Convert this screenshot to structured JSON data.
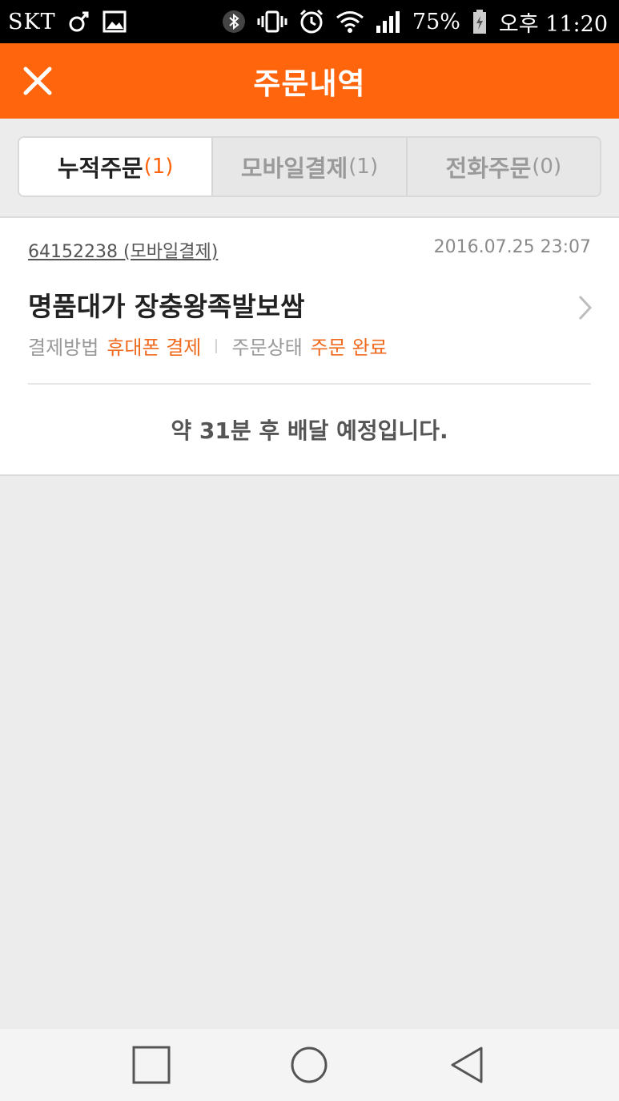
{
  "status_bar": {
    "carrier": "SKT",
    "battery": "75%",
    "time": "오후 11:20"
  },
  "app_bar": {
    "title": "주문내역"
  },
  "tabs": [
    {
      "label": "누적주문",
      "count": "(1)",
      "active": true
    },
    {
      "label": "모바일결제",
      "count": "(1)",
      "active": false
    },
    {
      "label": "전화주문",
      "count": "(0)",
      "active": false
    }
  ],
  "order": {
    "order_number": "64152238 (모바일결제)",
    "date": "2016.07.25 23:07",
    "store_name": "명품대가 장충왕족발보쌈",
    "payment_label": "결제방법",
    "payment_value": "휴대폰 결제",
    "status_label": "주문상태",
    "status_value": "주문 완료",
    "delivery_message": "약 31분 후 배달 예정입니다."
  },
  "colors": {
    "accent": "#ff650d",
    "accent_text": "#f06a1e"
  },
  "icons": {
    "close": "close-icon",
    "chevron": "chevron-right-icon",
    "nav_recent": "square-icon",
    "nav_home": "circle-icon",
    "nav_back": "triangle-back-icon"
  }
}
